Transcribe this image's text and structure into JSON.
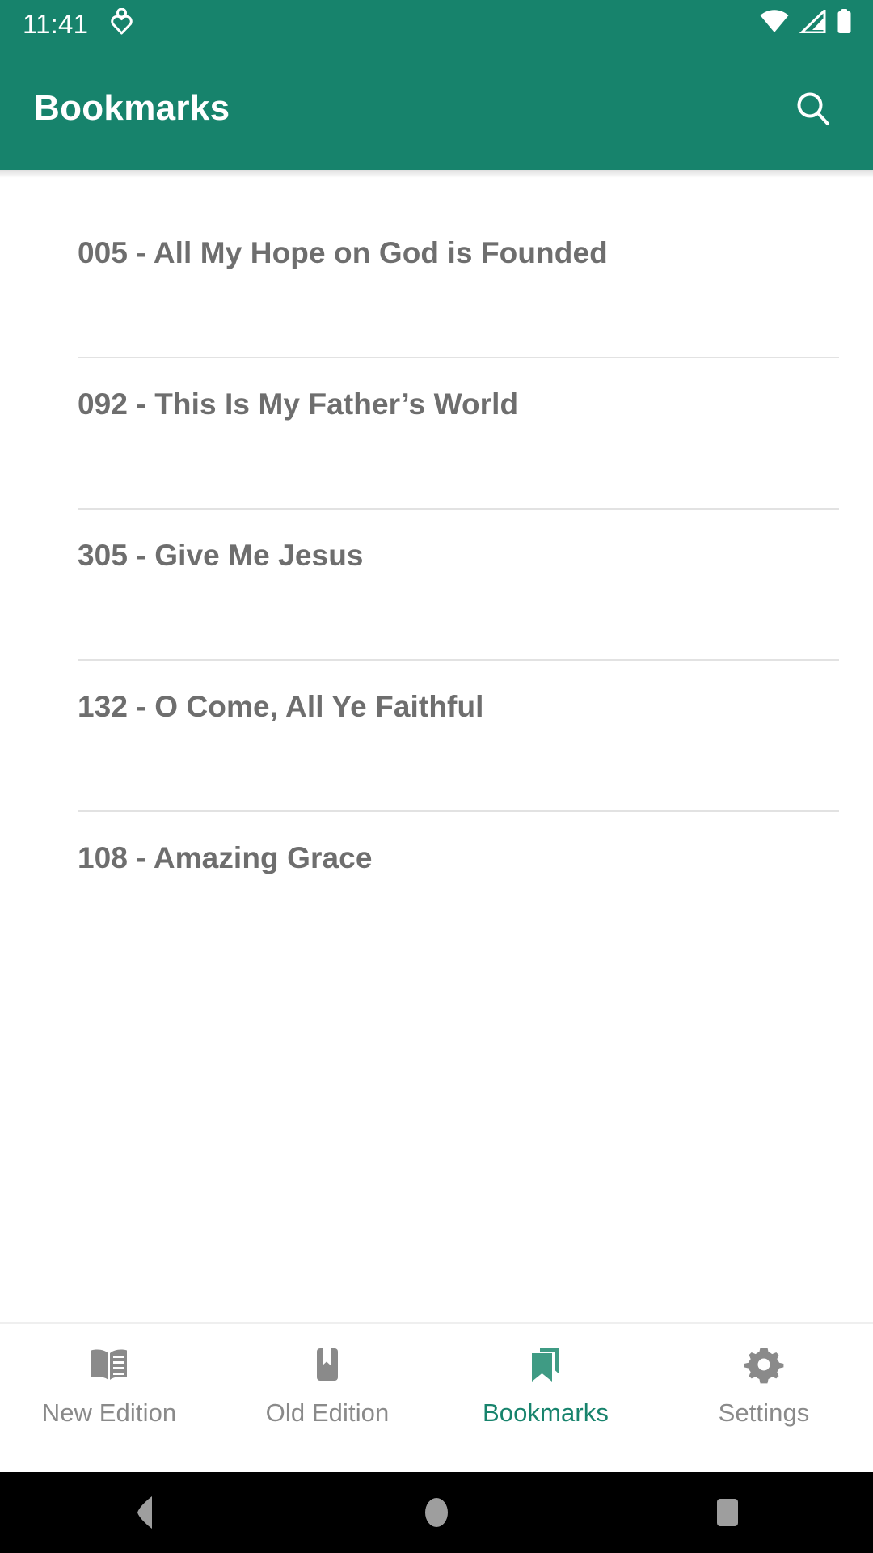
{
  "theme": {
    "primary": "#17836C",
    "on_primary": "#ffffff",
    "list_text": "#6e6e6e",
    "divider": "#e2e2e2",
    "nav_inactive": "#8a8a8a",
    "nav_active": "#17836C",
    "background": "#ffffff",
    "system_nav_bg": "#000000"
  },
  "status_bar": {
    "clock": "11:41",
    "left_icons": [
      {
        "name": "heart-person-icon"
      }
    ],
    "right_icons": [
      {
        "name": "wifi-icon"
      },
      {
        "name": "cellular-signal-icon"
      },
      {
        "name": "battery-icon"
      }
    ]
  },
  "app_bar": {
    "title": "Bookmarks",
    "search_icon": "search-icon"
  },
  "bookmarks": {
    "items": [
      {
        "label": "005 - All My Hope on God is Founded"
      },
      {
        "label": "092 - This Is My Father’s World"
      },
      {
        "label": "305 - Give Me Jesus"
      },
      {
        "label": "132 - O Come, All Ye Faithful"
      },
      {
        "label": "108 - Amazing Grace"
      }
    ]
  },
  "bottom_nav": {
    "items": [
      {
        "label": "New Edition",
        "icon": "open-book-icon",
        "active": false
      },
      {
        "label": "Old Edition",
        "icon": "book-bookmark-icon",
        "active": false
      },
      {
        "label": "Bookmarks",
        "icon": "bookmarks-icon",
        "active": true
      },
      {
        "label": "Settings",
        "icon": "gear-icon",
        "active": false
      }
    ]
  },
  "system_nav": {
    "back": "back-triangle-icon",
    "home": "home-circle-icon",
    "recents": "recents-square-icon"
  }
}
